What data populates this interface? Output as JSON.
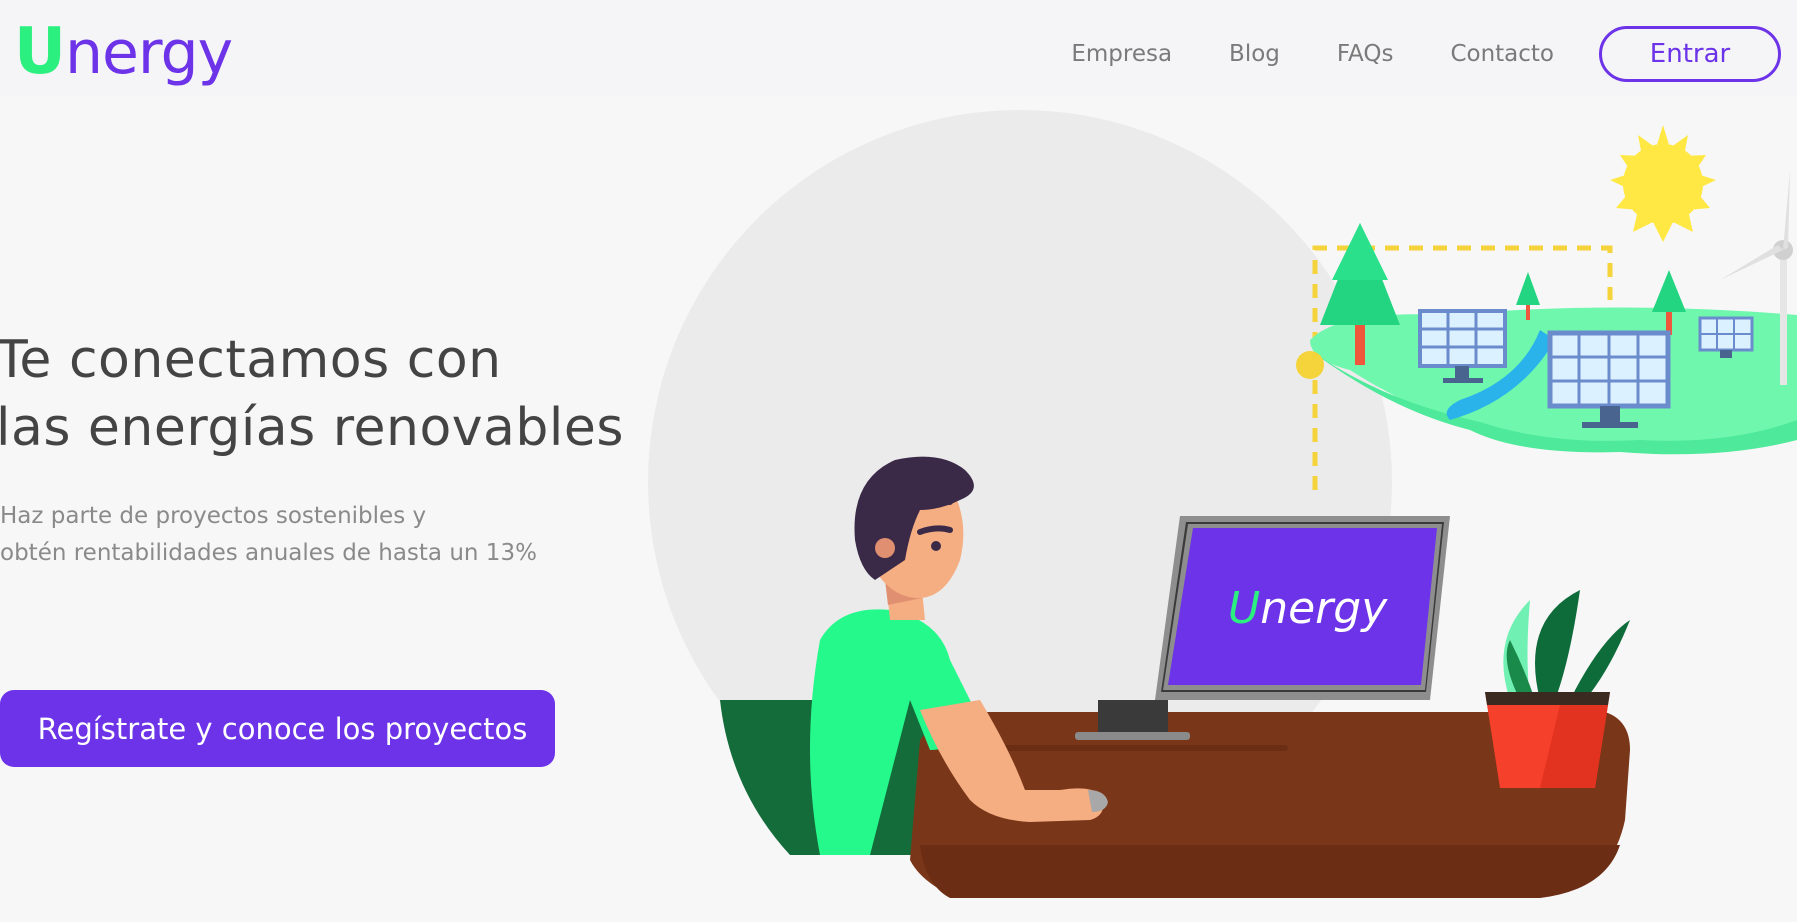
{
  "header": {
    "logo_text": "nergy",
    "logo_mark": "U",
    "nav": [
      "Empresa",
      "Blog",
      "FAQs",
      "Contacto"
    ],
    "login_label": "Entrar"
  },
  "hero": {
    "title_line1": "Te conectamos con",
    "title_line2": "las energías renovables",
    "subtitle_line1": "Haz parte de proyectos sostenibles y",
    "subtitle_line2": "obtén rentabilidades anuales de hasta un 13%",
    "cta_label": "Regístrate y conoce los proyectos"
  },
  "illustration": {
    "monitor_logo_mark": "U",
    "monitor_logo_text": "nergy",
    "icons": [
      "sun-icon",
      "tree-icon",
      "solar-panel-icon",
      "wind-turbine-icon",
      "plant-icon",
      "monitor-icon"
    ]
  },
  "colors": {
    "brand_purple": "#6c33e8",
    "brand_green": "#2bf07f",
    "desk_brown": "#7a3618"
  }
}
